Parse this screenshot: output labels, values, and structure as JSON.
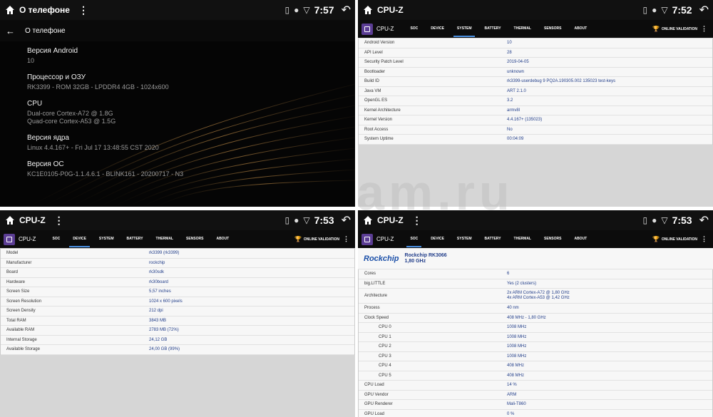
{
  "q1": {
    "status_title": "О телефоне",
    "time": "7:57",
    "page_title": "О телефоне",
    "items": [
      {
        "label": "Версия Android",
        "value": "10"
      },
      {
        "label": "Процессор и ОЗУ",
        "value": "RK3399 - ROM 32GB - LPDDR4 4GB - 1024x600"
      },
      {
        "label": "CPU",
        "value": "Dual-core Cortex-A72 @ 1.8G\nQuad-core Cortex-A53 @ 1.5G"
      },
      {
        "label": "Версия ядра",
        "value": "Linux 4.4.167+ - Fri Jul 17 13:48:55 CST 2020"
      },
      {
        "label": "Версия ОС",
        "value": "KC1E0105-P0G-1.1.4.6.1 - BLINK161 - 20200717 - N3"
      }
    ]
  },
  "cpuz": {
    "status_title": "CPU-Z",
    "app_name": "CPU-Z",
    "tabs": [
      "SOC",
      "DEVICE",
      "SYSTEM",
      "BATTERY",
      "THERMAL",
      "SENSORS",
      "ABOUT"
    ],
    "validation": "ONLINE VALIDATION"
  },
  "q2": {
    "time": "7:52",
    "active_tab": "SYSTEM",
    "rows": [
      {
        "k": "Android Version",
        "v": "10"
      },
      {
        "k": "API Level",
        "v": "28"
      },
      {
        "k": "Security Patch Level",
        "v": "2019-04-05"
      },
      {
        "k": "Bootloader",
        "v": "unknown"
      },
      {
        "k": "Build ID",
        "v": "rk3399-userdebug 9 PQ2A.190305.002 135023 test-keys"
      },
      {
        "k": "Java VM",
        "v": "ART 2.1.0"
      },
      {
        "k": "OpenGL ES",
        "v": "3.2"
      },
      {
        "k": "Kernel Architecture",
        "v": "armv8l"
      },
      {
        "k": "Kernel Version",
        "v": "4.4.167+ (135023)"
      },
      {
        "k": "Root Access",
        "v": "No"
      },
      {
        "k": "System Uptime",
        "v": "00:04:09"
      }
    ]
  },
  "q3": {
    "time": "7:53",
    "active_tab": "DEVICE",
    "rows": [
      {
        "k": "Model",
        "v": "rk3399 (rk3399)"
      },
      {
        "k": "Manufacturer",
        "v": "rockchip"
      },
      {
        "k": "Board",
        "v": "rk30sdk"
      },
      {
        "k": "Hardware",
        "v": "rk30board"
      },
      {
        "k": "Screen Size",
        "v": "5,57 inches"
      },
      {
        "k": "Screen Resolution",
        "v": "1024 x 600 pixels"
      },
      {
        "k": "Screen Density",
        "v": "212 dpi"
      },
      {
        "k": "Total RAM",
        "v": "3843 MB"
      },
      {
        "k": "Available RAM",
        "v": "2783 MB  (72%)"
      },
      {
        "k": "Internal Storage",
        "v": "24,12 GB"
      },
      {
        "k": "Available Storage",
        "v": "24,00 GB (99%)"
      }
    ]
  },
  "q4": {
    "time": "7:53",
    "active_tab": "SOC",
    "logo_text": "Rockchip",
    "chip_line1": "Rockchip RK3066",
    "chip_line2": "1,80 GHz",
    "rows": [
      {
        "k": "Cores",
        "v": "6",
        "sub": false
      },
      {
        "k": "big.LITTLE",
        "v": "Yes (2 clusters)",
        "sub": false
      },
      {
        "k": "Architecture",
        "v": "2x ARM Cortex-A72 @ 1,80 GHz\n4x ARM Cortex-A53 @ 1,42 GHz",
        "sub": false,
        "tall": true
      },
      {
        "k": "Process",
        "v": "40 nm",
        "sub": false
      },
      {
        "k": "Clock Speed",
        "v": "408 MHz - 1,80 GHz",
        "sub": false
      },
      {
        "k": "CPU 0",
        "v": "1008 MHz",
        "sub": true
      },
      {
        "k": "CPU 1",
        "v": "1008 MHz",
        "sub": true
      },
      {
        "k": "CPU 2",
        "v": "1008 MHz",
        "sub": true
      },
      {
        "k": "CPU 3",
        "v": "1008 MHz",
        "sub": true
      },
      {
        "k": "CPU 4",
        "v": "408 MHz",
        "sub": true
      },
      {
        "k": "CPU 5",
        "v": "408 MHz",
        "sub": true
      },
      {
        "k": "CPU Load",
        "v": "14 %",
        "sub": false
      },
      {
        "k": "GPU Vendor",
        "v": "ARM",
        "sub": false
      },
      {
        "k": "GPU Renderer",
        "v": "Mali-T860",
        "sub": false
      },
      {
        "k": "GPU Load",
        "v": "0 %",
        "sub": false
      }
    ]
  },
  "watermark": "am.ru",
  "colors": {
    "accent": "#4a90e2",
    "value_text": "#223e8a",
    "logo": "#5b3d94"
  }
}
